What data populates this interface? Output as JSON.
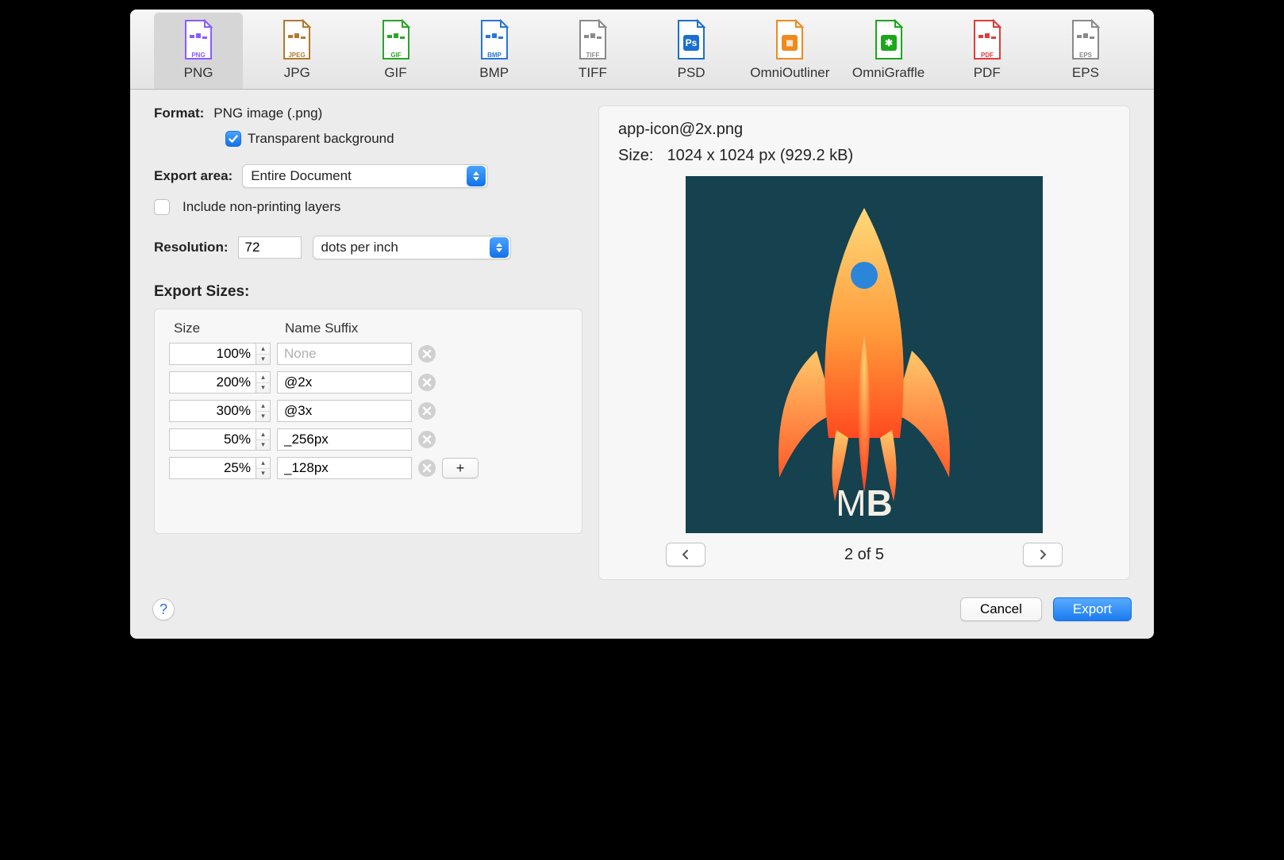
{
  "toolbar": {
    "items": [
      {
        "label": "PNG",
        "tag": "PNG",
        "color": "#8a5cff",
        "selected": true
      },
      {
        "label": "JPG",
        "tag": "JPEG",
        "color": "#b07a2e"
      },
      {
        "label": "GIF",
        "tag": "GIF",
        "color": "#2aa52a"
      },
      {
        "label": "BMP",
        "tag": "BMP",
        "color": "#2a76d6"
      },
      {
        "label": "TIFF",
        "tag": "TIFF",
        "color": "#8a8a8a"
      },
      {
        "label": "PSD",
        "tag": "Ps",
        "color": "#1b6fd0",
        "badge": true
      },
      {
        "label": "OmniOutliner",
        "tag": "≣",
        "color": "#f08a1d",
        "badge": true
      },
      {
        "label": "OmniGraffle",
        "tag": "✱",
        "color": "#1aa81a",
        "badge": true
      },
      {
        "label": "PDF",
        "tag": "PDF",
        "color": "#e23b3b"
      },
      {
        "label": "EPS",
        "tag": "EPS",
        "color": "#8a8a8a"
      }
    ]
  },
  "format": {
    "label": "Format:",
    "value": "PNG image (.png)"
  },
  "transparent": {
    "label": "Transparent background",
    "checked": true
  },
  "export_area": {
    "label": "Export area:",
    "value": "Entire Document"
  },
  "nonprinting": {
    "label": "Include non-printing layers",
    "checked": false
  },
  "resolution": {
    "label": "Resolution:",
    "value": "72",
    "unit": "dots per inch"
  },
  "export_sizes": {
    "title": "Export Sizes:",
    "headers": {
      "size": "Size",
      "suffix": "Name Suffix"
    },
    "placeholder": "None",
    "rows": [
      {
        "size": "100%",
        "suffix": ""
      },
      {
        "size": "200%",
        "suffix": "@2x"
      },
      {
        "size": "300%",
        "suffix": "@3x"
      },
      {
        "size": "50%",
        "suffix": "_256px"
      },
      {
        "size": "25%",
        "suffix": "_128px"
      }
    ]
  },
  "preview": {
    "filename": "app-icon@2x.png",
    "size_label": "Size:",
    "size_value": "1024 x 1024 px (929.2 kB)",
    "pager": "2 of 5",
    "logo_text_1": "M",
    "logo_text_2": "B"
  },
  "buttons": {
    "cancel": "Cancel",
    "export": "Export"
  }
}
